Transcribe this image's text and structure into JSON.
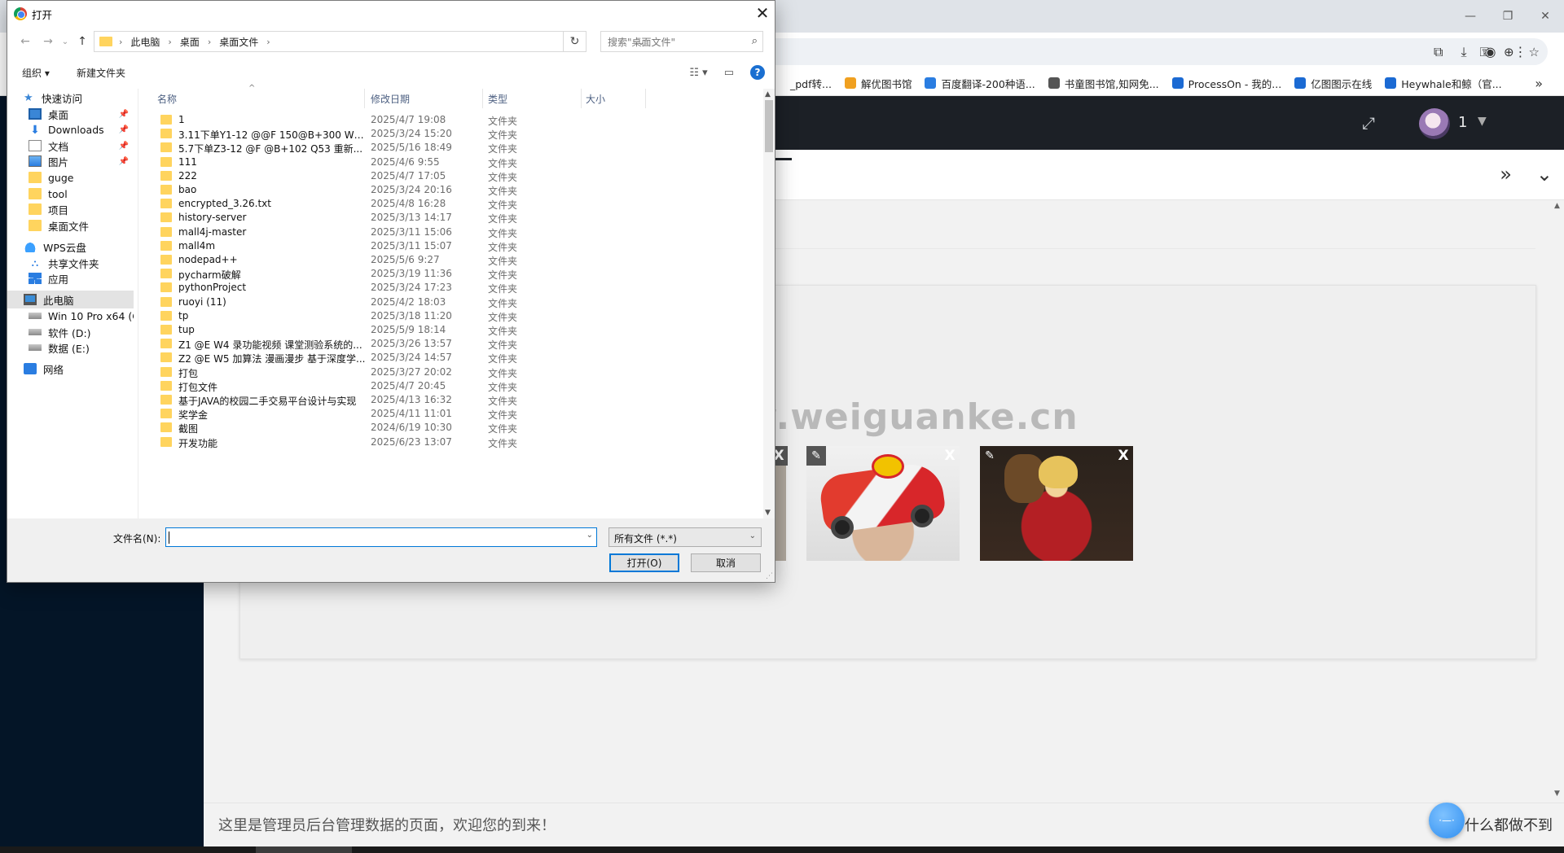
{
  "browser": {
    "window_controls": [
      "—",
      "❐",
      "✕"
    ],
    "bookmarks": [
      {
        "label": "_pdf转...",
        "color": "#ffffff"
      },
      {
        "label": "解优图书馆",
        "color": "#f0a020"
      },
      {
        "label": "百度翻译-200种语...",
        "color": "#2a7de1"
      },
      {
        "label": "书童图书馆,知网免...",
        "color": "#555555"
      },
      {
        "label": "ProcessOn - 我的...",
        "color": "#1b6ad3"
      },
      {
        "label": "亿图图示在线",
        "color": "#1b6ad3"
      },
      {
        "label": "Heywhale和鲸（官...",
        "color": "#1b6ad3"
      }
    ],
    "bookmarks_more": "»"
  },
  "app": {
    "header_user": "1",
    "tabs_right_icons": [
      "»",
      "⌄"
    ],
    "images": [
      {
        "name": "car",
        "edit": "✎",
        "delete": "X"
      },
      {
        "name": "figure",
        "edit": "✎",
        "delete": "X"
      }
    ],
    "partial_delete": "X",
    "footer_text": "这里是管理员后台管理数据的页面，欢迎您的到来！",
    "footer_right": "什么都做不到",
    "float_ball_label": "·—·"
  },
  "watermark": "cn围观客www.weiguanke.cn",
  "dialog": {
    "title": "打开",
    "close": "✕",
    "nav": {
      "back": "←",
      "forward": "→",
      "dropdown": "⌄",
      "up": "↑"
    },
    "breadcrumb": [
      "此电脑",
      "桌面",
      "桌面文件"
    ],
    "search_placeholder": "搜索\"桌面文件\"",
    "commands": {
      "organize": "组织 ▾",
      "new_folder": "新建文件夹"
    },
    "nav_pane": [
      {
        "label": "快速访问",
        "icon": "star-icon",
        "level": 0,
        "pin": false
      },
      {
        "label": "桌面",
        "icon": "desktop-icon",
        "level": 1,
        "pin": true
      },
      {
        "label": "Downloads",
        "icon": "download-icon",
        "level": 1,
        "pin": true
      },
      {
        "label": "文档",
        "icon": "document-icon",
        "level": 1,
        "pin": true
      },
      {
        "label": "图片",
        "icon": "pictures-icon",
        "level": 1,
        "pin": true
      },
      {
        "label": "guge",
        "icon": "folder-icon",
        "level": 1,
        "pin": false
      },
      {
        "label": "tool",
        "icon": "folder-icon",
        "level": 1,
        "pin": false
      },
      {
        "label": "项目",
        "icon": "folder-icon",
        "level": 1,
        "pin": false
      },
      {
        "label": "桌面文件",
        "icon": "folder-icon",
        "level": 1,
        "pin": false
      },
      {
        "label": "WPS云盘",
        "icon": "cloud-icon",
        "level": 0,
        "pin": false
      },
      {
        "label": "共享文件夹",
        "icon": "share-icon",
        "level": 1,
        "pin": false
      },
      {
        "label": "应用",
        "icon": "apps-icon",
        "level": 1,
        "pin": false
      },
      {
        "label": "此电脑",
        "icon": "pc-icon",
        "level": 0,
        "pin": false,
        "selected": true
      },
      {
        "label": "Win 10 Pro x64 (C",
        "icon": "drive-icon",
        "level": 1,
        "pin": false
      },
      {
        "label": "软件 (D:)",
        "icon": "drive-icon",
        "level": 1,
        "pin": false
      },
      {
        "label": "数据 (E:)",
        "icon": "drive-icon",
        "level": 1,
        "pin": false
      },
      {
        "label": "网络",
        "icon": "network-icon",
        "level": 0,
        "pin": false
      }
    ],
    "pin_glyph": "📌",
    "columns": [
      "名称",
      "修改日期",
      "类型",
      "大小"
    ],
    "files": [
      {
        "name": "1",
        "date": "2025/4/7 19:08",
        "type": "文件夹"
      },
      {
        "name": "3.11下单Y1-12 @@F 150@B+300 W1 ...",
        "date": "2025/3/24 15:20",
        "type": "文件夹"
      },
      {
        "name": "5.7下单Z3-12 @F @B+102 Q53 重新...",
        "date": "2025/5/16 18:49",
        "type": "文件夹"
      },
      {
        "name": "111",
        "date": "2025/4/6 9:55",
        "type": "文件夹"
      },
      {
        "name": "222",
        "date": "2025/4/7 17:05",
        "type": "文件夹"
      },
      {
        "name": "bao",
        "date": "2025/3/24 20:16",
        "type": "文件夹"
      },
      {
        "name": "encrypted_3.26.txt",
        "date": "2025/4/8 16:28",
        "type": "文件夹"
      },
      {
        "name": "history-server",
        "date": "2025/3/13 14:17",
        "type": "文件夹"
      },
      {
        "name": "mall4j-master",
        "date": "2025/3/11 15:06",
        "type": "文件夹"
      },
      {
        "name": "mall4m",
        "date": "2025/3/11 15:07",
        "type": "文件夹"
      },
      {
        "name": "nodepad++",
        "date": "2025/5/6 9:27",
        "type": "文件夹"
      },
      {
        "name": "pycharm破解",
        "date": "2025/3/19 11:36",
        "type": "文件夹"
      },
      {
        "name": "pythonProject",
        "date": "2025/3/24 17:23",
        "type": "文件夹"
      },
      {
        "name": "ruoyi (11)",
        "date": "2025/4/2 18:03",
        "type": "文件夹"
      },
      {
        "name": "tp",
        "date": "2025/3/18 11:20",
        "type": "文件夹"
      },
      {
        "name": "tup",
        "date": "2025/5/9 18:14",
        "type": "文件夹"
      },
      {
        "name": "Z1 @E W4 录功能视频 课堂测验系统的...",
        "date": "2025/3/26 13:57",
        "type": "文件夹"
      },
      {
        "name": "Z2 @E W5 加算法 漫画漫步 基于深度学...",
        "date": "2025/3/24 14:57",
        "type": "文件夹"
      },
      {
        "name": "打包",
        "date": "2025/3/27 20:02",
        "type": "文件夹"
      },
      {
        "name": "打包文件",
        "date": "2025/4/7 20:45",
        "type": "文件夹"
      },
      {
        "name": "基于JAVA的校园二手交易平台设计与实现",
        "date": "2025/4/13 16:32",
        "type": "文件夹"
      },
      {
        "name": "奖学金",
        "date": "2025/4/11 11:01",
        "type": "文件夹"
      },
      {
        "name": "截图",
        "date": "2024/6/19 10:30",
        "type": "文件夹"
      },
      {
        "name": "开发功能",
        "date": "2025/6/23 13:07",
        "type": "文件夹"
      }
    ],
    "filename_label": "文件名(N):",
    "filename_value": "",
    "filetype_selected": "所有文件 (*.*)",
    "open_button": "打开(O)",
    "cancel_button": "取消"
  }
}
